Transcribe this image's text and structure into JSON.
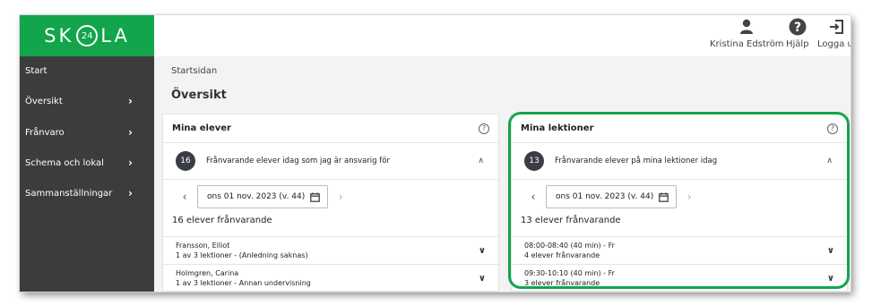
{
  "brand": {
    "pre": "SK",
    "ring": "24",
    "post": "LA",
    "color": "#12a54b"
  },
  "header": {
    "user_label": "Kristina Edström",
    "help_label": "Hjälp",
    "logout_label": "Logga ut"
  },
  "sidebar": {
    "items": [
      {
        "label": "Start",
        "has_chevron": false
      },
      {
        "label": "Översikt",
        "has_chevron": true,
        "chevron": ">"
      },
      {
        "label": "Frånvaro",
        "has_chevron": true,
        "chevron": ">"
      },
      {
        "label": "Schema och lokal",
        "has_chevron": true,
        "chevron": ">"
      },
      {
        "label": "Sammanställningar",
        "has_chevron": true,
        "chevron": ">"
      }
    ]
  },
  "breadcrumb": "Startsidan",
  "page_title": "Översikt",
  "cards": {
    "students": {
      "title": "Mina elever",
      "help": "?",
      "badge": "16",
      "summary": "Frånvarande elever idag som jag är ansvarig för",
      "collapse": "^",
      "prev": "<",
      "next": ">",
      "date": "ons 01 nov. 2023 (v. 44)",
      "total": "16 elever frånvarande",
      "rows": [
        {
          "line1": "Fransson, Elliot",
          "line2": "1 av 3 lektioner - (Anledning saknas)",
          "chevron": "v"
        },
        {
          "line1": "Holmgren, Carina",
          "line2": "1 av 3 lektioner - Annan undervisning",
          "chevron": "v"
        }
      ]
    },
    "lessons": {
      "title": "Mina lektioner",
      "help": "?",
      "badge": "13",
      "summary": "Frånvarande elever på mina lektioner idag",
      "collapse": "^",
      "prev": "<",
      "next": ">",
      "date": "ons 01 nov. 2023 (v. 44)",
      "total": "13 elever frånvarande",
      "rows": [
        {
          "line1": "08:00-08:40 (40 min) - Fr",
          "line2": "4 elever frånvarande",
          "chevron": "v"
        },
        {
          "line1": "09:30-10:10 (40 min) - Fr",
          "line2": "3 elever frånvarande",
          "chevron": "v"
        }
      ]
    }
  },
  "colors": {
    "brand_green": "#12a54b",
    "sidebar_bg": "#3b3d3d",
    "badge_bg": "#3b3d45",
    "page_bg": "#f3f3f3"
  }
}
